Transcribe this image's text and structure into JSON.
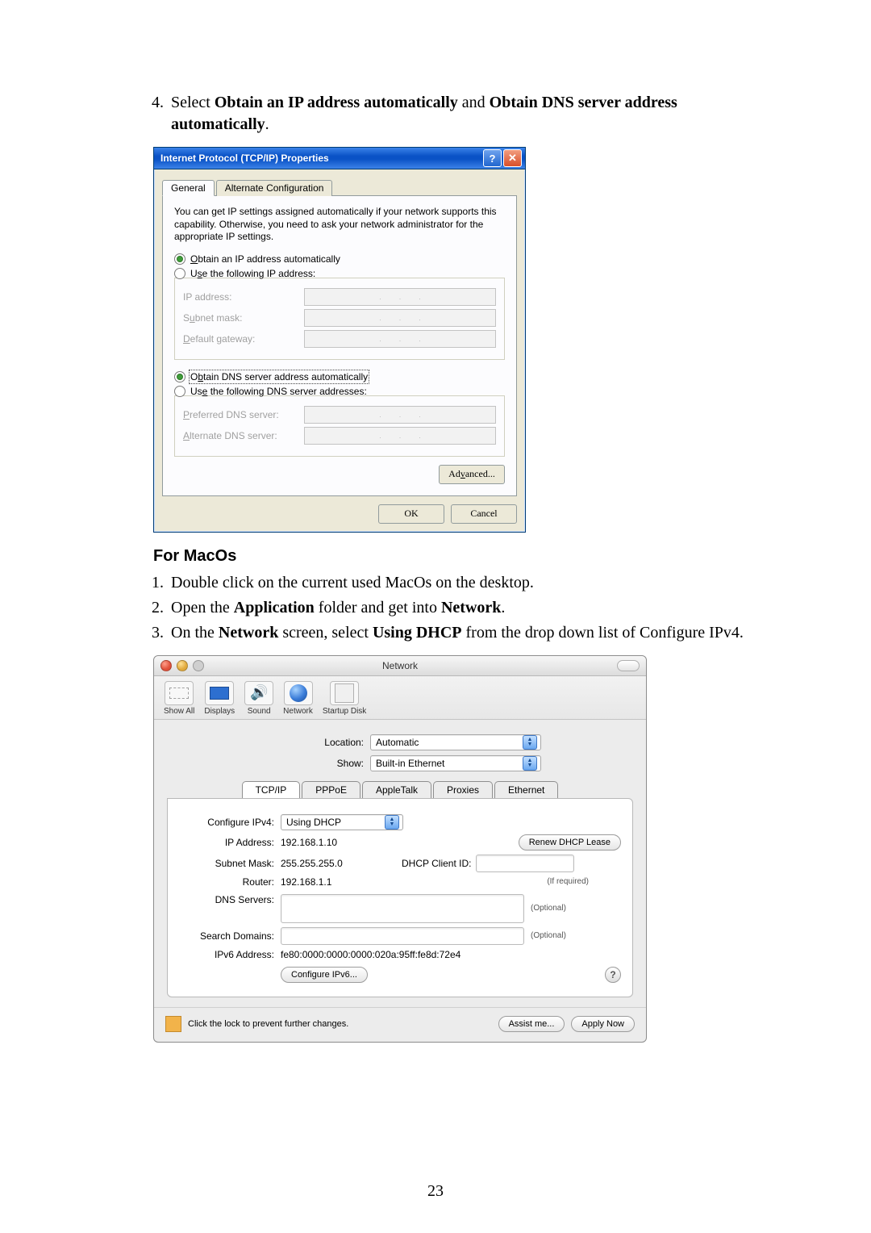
{
  "page_number": "23",
  "step4": {
    "prefix": "Select ",
    "opt1": "Obtain an IP address automatically",
    "mid": " and ",
    "opt2": "Obtain DNS server address automatically",
    "suffix": "."
  },
  "xp": {
    "title": "Internet Protocol (TCP/IP) Properties",
    "tab_general": "General",
    "tab_alt": "Alternate Configuration",
    "desc": "You can get IP settings assigned automatically if your network supports this capability. Otherwise, you need to ask your network administrator for the appropriate IP settings.",
    "r_ip_auto": "Obtain an IP address automatically",
    "r_ip_manual": "Use the following IP address:",
    "f_ip": "IP address:",
    "f_subnet": "Subnet mask:",
    "f_gateway": "Default gateway:",
    "r_dns_auto": "Obtain DNS server address automatically",
    "r_dns_manual": "Use the following DNS server addresses:",
    "f_pref_dns": "Preferred DNS server:",
    "f_alt_dns": "Alternate DNS server:",
    "btn_adv": "Advanced...",
    "btn_ok": "OK",
    "btn_cancel": "Cancel"
  },
  "macos_heading": "For MacOs",
  "mac_steps": {
    "s1": "Double click on the current used MacOs on the desktop.",
    "s2_a": "Open the ",
    "s2_b": "Application",
    "s2_c": " folder and get into ",
    "s2_d": "Network",
    "s2_e": ".",
    "s3_a": "On the ",
    "s3_b": "Network",
    "s3_c": " screen, select ",
    "s3_d": "Using DHCP",
    "s3_e": " from the drop down list of Configure IPv4."
  },
  "mac": {
    "win_title": "Network",
    "toolbar": {
      "show_all": "Show All",
      "displays": "Displays",
      "sound": "Sound",
      "network": "Network",
      "startup": "Startup Disk"
    },
    "location_lbl": "Location:",
    "location_val": "Automatic",
    "show_lbl": "Show:",
    "show_val": "Built-in Ethernet",
    "tabs": {
      "tcpip": "TCP/IP",
      "pppoe": "PPPoE",
      "appletalk": "AppleTalk",
      "proxies": "Proxies",
      "ethernet": "Ethernet"
    },
    "cfg_lbl": "Configure IPv4:",
    "cfg_val": "Using DHCP",
    "ip_lbl": "IP Address:",
    "ip_val": "192.168.1.10",
    "renew_btn": "Renew DHCP Lease",
    "subnet_lbl": "Subnet Mask:",
    "subnet_val": "255.255.255.0",
    "dhcp_client_lbl": "DHCP Client ID:",
    "dhcp_client_hint": "(If required)",
    "router_lbl": "Router:",
    "router_val": "192.168.1.1",
    "dns_lbl": "DNS Servers:",
    "optional": "(Optional)",
    "search_lbl": "Search Domains:",
    "ipv6_lbl": "IPv6 Address:",
    "ipv6_val": "fe80:0000:0000:0000:020a:95ff:fe8d:72e4",
    "cfg_ipv6_btn": "Configure IPv6...",
    "lock_text": "Click the lock to prevent further changes.",
    "assist_btn": "Assist me...",
    "apply_btn": "Apply Now"
  }
}
